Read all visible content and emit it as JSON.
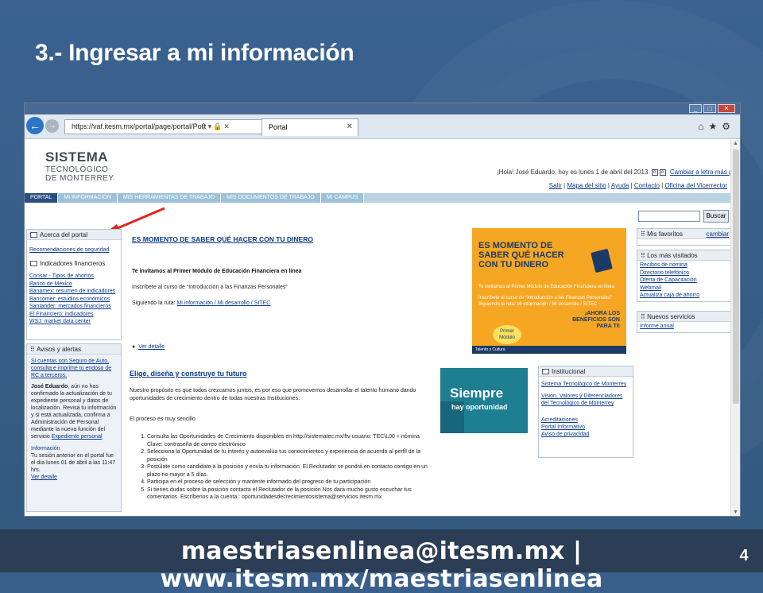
{
  "slide": {
    "title": "3.- Ingresar a mi información",
    "footer": "maestriasenlinea@itesm.mx | www.itesm.mx/maestriasenlinea",
    "page_number": "4"
  },
  "browser": {
    "url": "https://vaf.itesm.mx/portal/page/portal/Port",
    "tab_label": "Portal",
    "window_controls": [
      "minimize-icon",
      "maximize-icon",
      "close-icon"
    ]
  },
  "header": {
    "logo_line1": "SISTEMA",
    "logo_line2": "TECNOLÓGICO",
    "logo_line3": "DE MONTERREY.",
    "greeting": "¡Hola! José Eduardo, hoy es lunes 1 de abril del 2013",
    "font_size_link": "Cambiar a letra más grande",
    "util_links": [
      "Salir",
      "Mapa del sitio",
      "Ayuda",
      "Contacto",
      "Oficina del Vicerrector"
    ]
  },
  "nav": {
    "tabs": [
      "PORTAL",
      "MI INFORMACIÓN",
      "MIS HERRAMIENTAS DE TRABAJO",
      "MIS DOCUMENTOS DE TRABAJO",
      "MI CAMPUS"
    ]
  },
  "search": {
    "button": "Buscar",
    "value": ""
  },
  "left": {
    "acerca_title": "Acerca del portal",
    "acerca_link": "Recomendaciones de seguridad",
    "indicadores_title": "Indicadores financieros",
    "indicadores_links": [
      "Consar - Tipos de ahorros",
      "Banco de México",
      "Banamex: resumen de indicadores",
      "Bancomer: estudios económicos",
      "Santander: mercados financieros",
      "El Financiero: indicadores",
      "WSJ: market data center"
    ],
    "avisos_title": "Avisos y alertas",
    "aviso1": "Si cuentas con Seguro de Auto, consulta e imprime tu endoso de RC a terceros.",
    "aviso2_name": "José Eduardo",
    "aviso2_text": ", aún no has confirmado la actualización de tu expediente personal y datos de localización. Revisa tu información y si está actualizada, confirma a Administración de Personal mediante la nueva función del servicio ",
    "aviso2_link": "Expediente personal",
    "info_title": "Información",
    "info_text": "Tu sesión anterior en el portal fue el día lunes 01 de abril a las 11:47 hrs.",
    "info_link": "Ver detalle"
  },
  "main": {
    "heading1": "ES MOMENTO DE SABER QUÉ HACER CON TU DINERO",
    "p1": "Te invitamos al Primer Módulo de Educación Financiera en línea",
    "p2": "Inscríbete al curso de “Introducción a las Finanzas Personales”",
    "p3_prefix": "Siguiendo la ruta: ",
    "p3_link": "Mi información / Mi desarrollo / SITEC",
    "ver_detalle": "Ver detalle",
    "heading2": "Elige, diseña y construye tu futuro",
    "p4": "Nuestro propósito es que todos crezcamos juntos, es por eso que promovemos desarrollar el talento humano dando oportunidades de crecimiento dentro de todas nuestras Instituciones.",
    "p5": "El proceso es muy sencillo",
    "steps": [
      "Consulta las Oportunidades de Crecimiento disponibles en http://sistematec.mx/ftv usuario: TEC\\L00 + nómina Clave: contraseña de correo electrónico",
      "Selecciona la Oportunidad de tu interés y autoevalúa tus conocimientos y experiencia de acuerdo al perfil de la posición",
      "Postúlate como candidato a la posición y envía tu información. El Reclutador se pondrá en contacto contigo en un plazo no mayor a 5 días.",
      "Participa en el proceso de selección y mantente informado del progreso de tu participación",
      "Si tienes dudas sobre la posición contacta el Reclutador de la posición Nos dará mucho gusto escuchar tus comentarios. Escríbenos a la cuenta : oportunidadesdecrecimientosistema@servicios.itesm.mx"
    ],
    "banner1_title": "ES MOMENTO DE SABER QUÉ HACER CON TU DINERO",
    "banner1_sub1": "Te invitamos al Primer Módulo de Educación Financiera en línea",
    "banner1_sub2": "Inscríbete al curso de \"Introducción a las Finanzas Personales\" Siguiendo la ruta: Mi información / Mi desarrollo / SITEC",
    "banner1_right": "¡AHORA LOS BENEFICIOS SON PARA TI!",
    "banner1_module": "Primer Módulo",
    "banner1_footer": "Talento y Cultura",
    "banner2_t1": "Siempre",
    "banner2_t2": "hay oportunidad"
  },
  "institucional": {
    "title": "Institucional",
    "links1": [
      "Sistema Tecnológico de Monterrey",
      "Visión, Valores y Diferenciadores del Tecnológico de Monterrey"
    ],
    "links2": [
      "Acreditaciones",
      "Portal Informativo",
      "Aviso de privacidad"
    ]
  },
  "right": {
    "favoritos_title": "Mis favoritos",
    "favoritos_action": "cambiar",
    "visitados_title": "Los más visitados",
    "visitados": [
      "Recibos de nómina",
      "Directorio telefónico",
      "Oferta de Capacitación",
      "Webmail",
      "Actualiza caja de ahorro"
    ],
    "nuevos_title": "Nuevos servicios",
    "nuevos": [
      "Informe anual"
    ]
  }
}
